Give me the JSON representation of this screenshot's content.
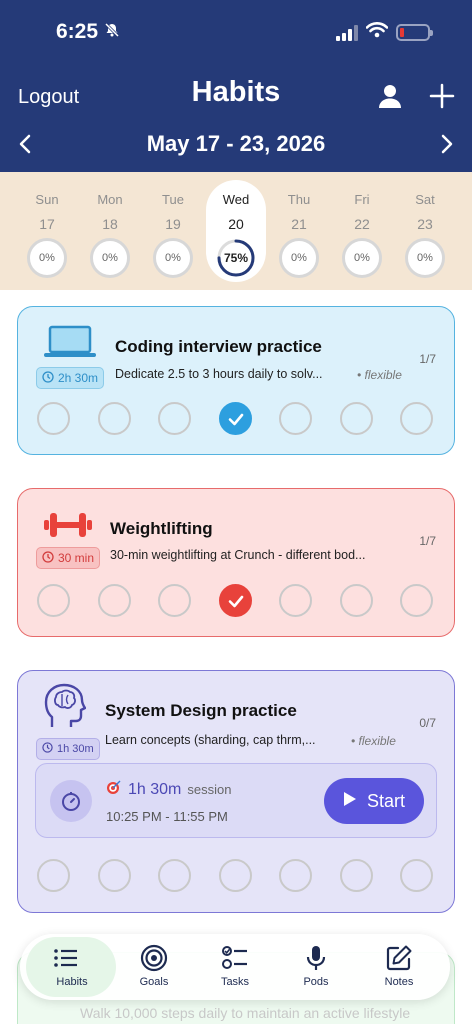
{
  "status_bar": {
    "time": "6:25"
  },
  "header": {
    "logout_label": "Logout",
    "title": "Habits",
    "date_range": "May 17 - 23, 2026"
  },
  "week": {
    "days": [
      {
        "name": "Sun",
        "num": "17",
        "pct": "0%"
      },
      {
        "name": "Mon",
        "num": "18",
        "pct": "0%"
      },
      {
        "name": "Tue",
        "num": "19",
        "pct": "0%"
      },
      {
        "name": "Wed",
        "num": "20",
        "pct": "75%",
        "selected": true,
        "progress": 0.75
      },
      {
        "name": "Thu",
        "num": "21",
        "pct": "0%"
      },
      {
        "name": "Fri",
        "num": "22",
        "pct": "0%"
      },
      {
        "name": "Sat",
        "num": "23",
        "pct": "0%"
      }
    ]
  },
  "habits": [
    {
      "title": "Coding interview practice",
      "badge": "2h 30m",
      "description": "Dedicate 2.5 to 3 hours daily to solv...",
      "tag": "• flexible",
      "count": "1/7",
      "done_day": 3,
      "color": "#2d9fdf"
    },
    {
      "title": "Weightlifting",
      "badge": "30 min",
      "description": "30-min weightlifting at Crunch - different bod...",
      "tag": "",
      "count": "1/7",
      "done_day": 3,
      "color": "#e8423b"
    },
    {
      "title": "System Design practice",
      "badge": "1h 30m",
      "description": "Learn concepts (sharding, cap thrm,...",
      "tag": "• flexible",
      "count": "0/7",
      "done_day": -1,
      "color": "#5a55dc",
      "session": {
        "duration": "1h 30m",
        "label": "session",
        "time_range": "10:25 PM - 11:55 PM",
        "start_label": "Start"
      }
    }
  ],
  "ghost_card": {
    "text": "Walk 10,000 steps daily to maintain an active lifestyle"
  },
  "nav": {
    "items": [
      {
        "label": "Habits",
        "icon": "list-icon",
        "active": true
      },
      {
        "label": "Goals",
        "icon": "target-icon"
      },
      {
        "label": "Tasks",
        "icon": "tasks-icon"
      },
      {
        "label": "Pods",
        "icon": "microphone-icon"
      },
      {
        "label": "Notes",
        "icon": "edit-note-icon"
      }
    ]
  }
}
